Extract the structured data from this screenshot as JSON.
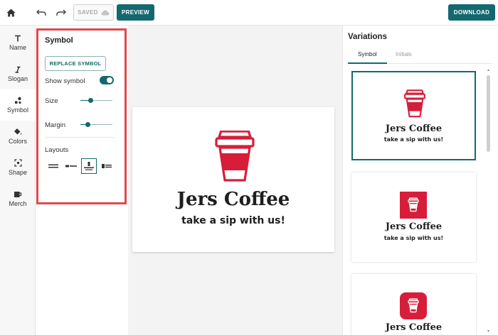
{
  "toolbar": {
    "saved_label": "SAVED",
    "preview_label": "PREVIEW",
    "download_label": "DOWNLOAD",
    "icons": [
      "home-icon",
      "undo-icon",
      "redo-icon",
      "cloud-icon"
    ]
  },
  "nav": {
    "items": [
      {
        "label": "Name",
        "icon": "text-icon"
      },
      {
        "label": "Slogan",
        "icon": "italic-icon"
      },
      {
        "label": "Symbol",
        "icon": "shapes-icon"
      },
      {
        "label": "Colors",
        "icon": "paint-bucket-icon"
      },
      {
        "label": "Shape",
        "icon": "frame-icon"
      },
      {
        "label": "Merch",
        "icon": "mug-icon"
      }
    ],
    "active": "Symbol"
  },
  "panel": {
    "title": "Symbol",
    "replace_label": "REPLACE SYMBOL",
    "show_symbol_label": "Show symbol",
    "show_symbol": true,
    "size_label": "Size",
    "size_value": 0.3,
    "margin_label": "Margin",
    "margin_value": 0.18,
    "layouts_label": "Layouts",
    "layouts_selected": 2
  },
  "logo": {
    "name": "Jers Coffee",
    "slogan": "take a sip with us!",
    "accent": "#d61e3a",
    "ink": "#1e1e1e"
  },
  "variations": {
    "title": "Variations",
    "tabs": [
      "Symbol",
      "Initials"
    ],
    "active_tab": "Symbol"
  },
  "colors": {
    "teal": "#13696f",
    "highlight": "#e2474b"
  }
}
